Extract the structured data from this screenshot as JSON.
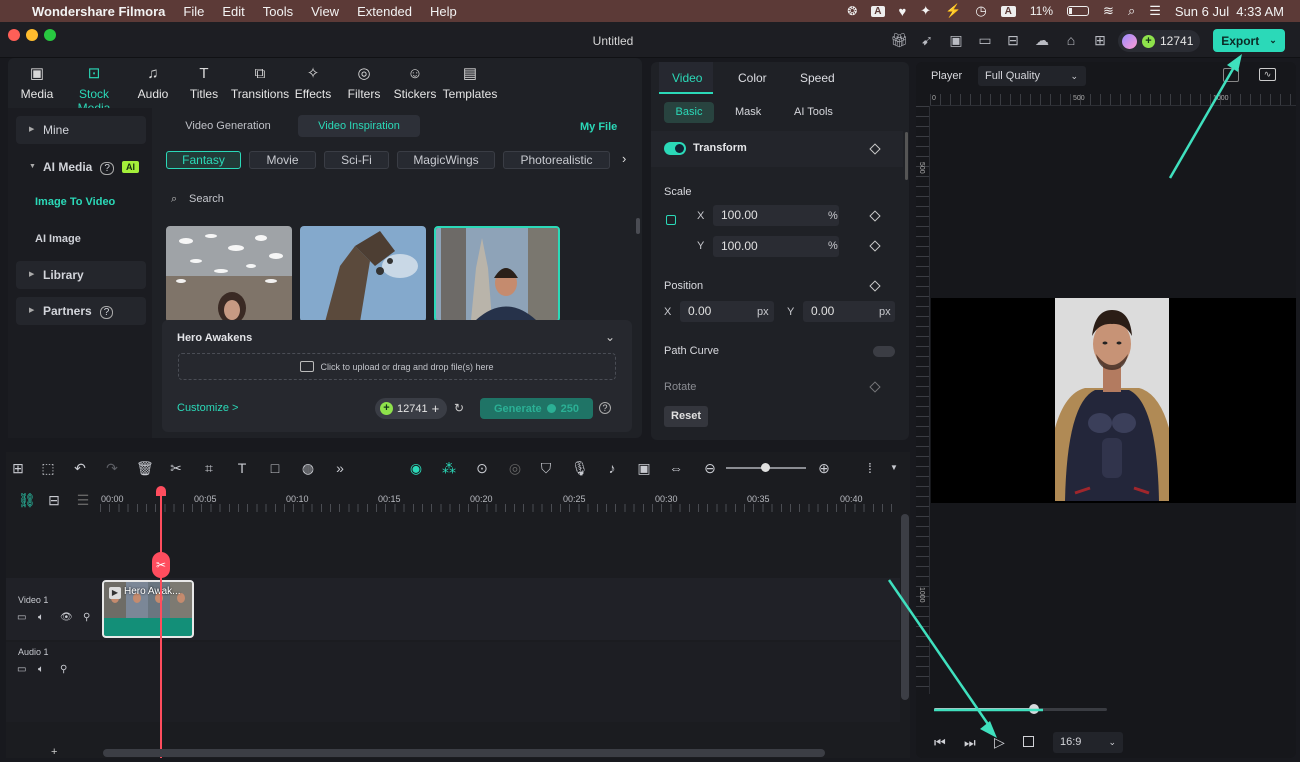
{
  "menubar": {
    "app_name": "Wondershare Filmora",
    "menus": [
      "File",
      "Edit",
      "Tools",
      "View",
      "Extended",
      "Help"
    ],
    "battery": "11%",
    "datetime": "Sun 6 Jul  4:33 AM"
  },
  "titlebar": {
    "title": "Untitled",
    "credits": "12741",
    "export_label": "Export"
  },
  "media_tabs": [
    {
      "label": "Media"
    },
    {
      "label": "Stock Media"
    },
    {
      "label": "Audio"
    },
    {
      "label": "Titles"
    },
    {
      "label": "Transitions"
    },
    {
      "label": "Effects"
    },
    {
      "label": "Filters"
    },
    {
      "label": "Stickers"
    },
    {
      "label": "Templates"
    }
  ],
  "sidebar": {
    "mine": "Mine",
    "ai_media": "AI Media",
    "ai_badge": "AI",
    "image_to_video": "Image To Video",
    "ai_image": "AI Image",
    "library": "Library",
    "partners": "Partners"
  },
  "content": {
    "sub_tabs": [
      "Video Generation",
      "Video Inspiration"
    ],
    "my_file": "My File",
    "categories": [
      "Fantasy",
      "Movie",
      "Sci-Fi",
      "MagicWings",
      "Photorealistic"
    ],
    "search_placeholder": "Search",
    "hero_title": "Hero Awakens",
    "upload_text": "Click to upload or drag and drop file(s) here",
    "customize": "Customize >",
    "credits": "12741",
    "generate": "Generate",
    "generate_cost": "250"
  },
  "properties": {
    "tabs": [
      "Video",
      "Color",
      "Speed"
    ],
    "sub_tabs": [
      "Basic",
      "Mask",
      "AI Tools"
    ],
    "transform": "Transform",
    "scale": "Scale",
    "scale_x_label": "X",
    "scale_x": "100.00",
    "scale_y_label": "Y",
    "scale_y": "100.00",
    "percent": "%",
    "position": "Position",
    "pos_x_label": "X",
    "pos_x": "0.00",
    "pos_y_label": "Y",
    "pos_y": "0.00",
    "px": "px",
    "path_curve": "Path Curve",
    "rotate": "Rotate",
    "reset": "Reset"
  },
  "player": {
    "label": "Player",
    "quality": "Full Quality",
    "ruler_h": [
      "0",
      "500",
      "1000"
    ],
    "ruler_v": [
      "500",
      "1000"
    ],
    "aspect": "16:9",
    "progress": 0.58
  },
  "timeline": {
    "ruler": [
      "00:00",
      "00:05",
      "00:10",
      "00:15",
      "00:20",
      "00:25",
      "00:30",
      "00:35",
      "00:40"
    ],
    "video_track": "Video 1",
    "audio_track": "Audio 1",
    "clip_title": "Hero Awak..."
  },
  "colors": {
    "accent": "#2bd9b8",
    "playhead": "#ff4d5e",
    "menubar": "#5c3a37"
  }
}
